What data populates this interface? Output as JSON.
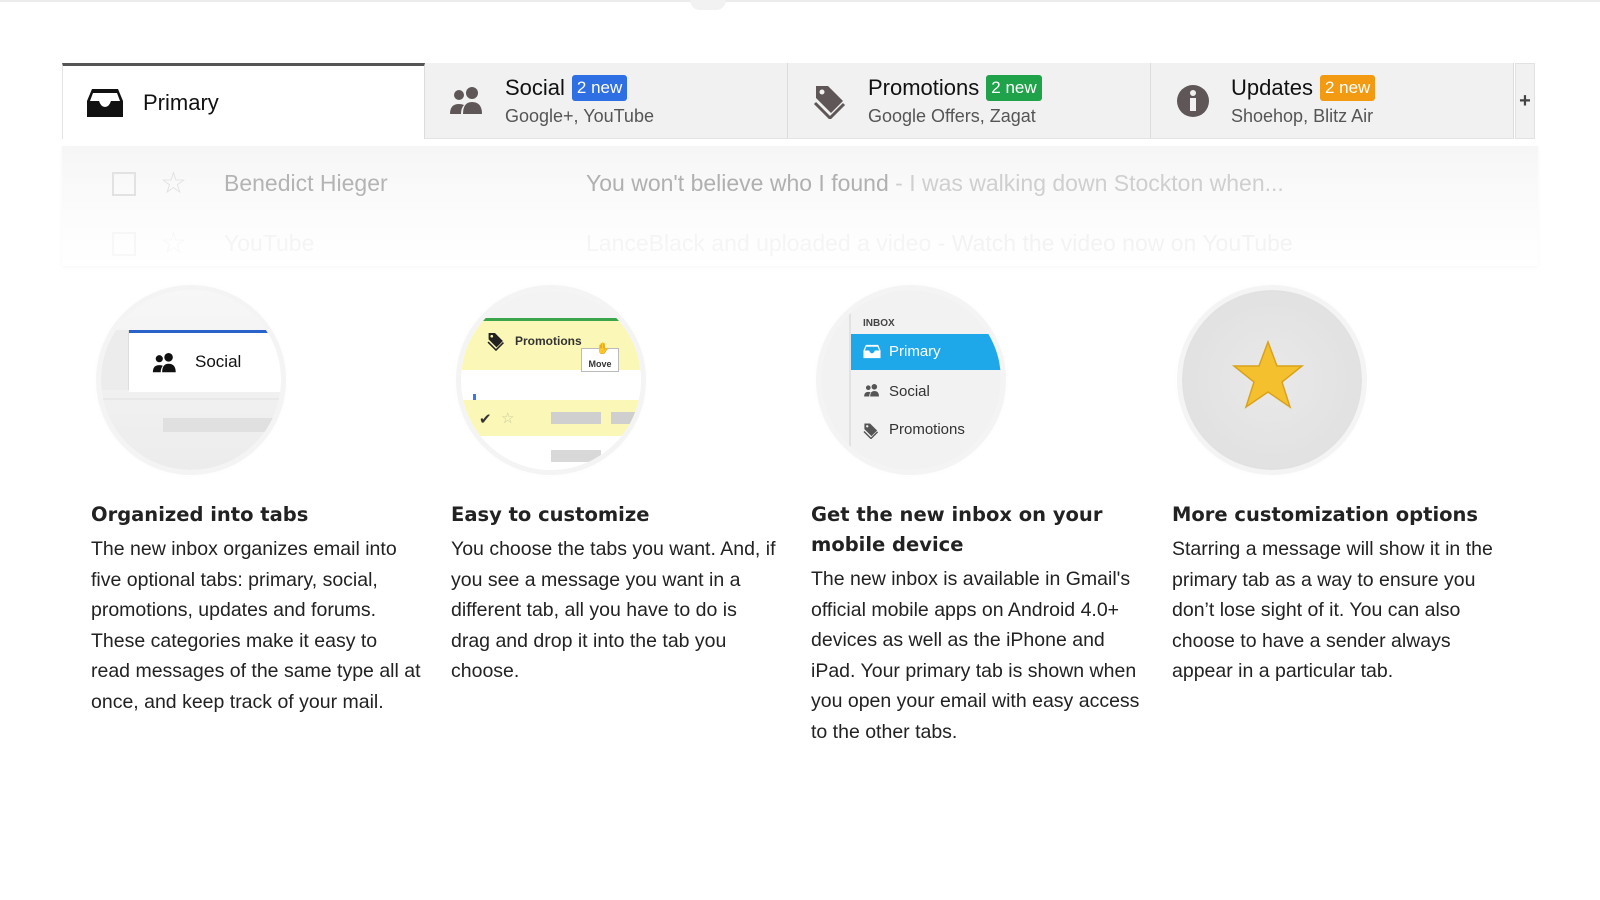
{
  "tabs": [
    {
      "label": "Primary",
      "icon": "inbox-icon",
      "active": true
    },
    {
      "label": "Social",
      "badge": "2 new",
      "badge_color": "#2f6fe4",
      "subtitle": "Google+, YouTube",
      "icon": "people-icon"
    },
    {
      "label": "Promotions",
      "badge": "2 new",
      "badge_color": "#1fa24a",
      "subtitle": "Google Offers, Zagat",
      "icon": "tag-icon"
    },
    {
      "label": "Updates",
      "badge": "2 new",
      "badge_color": "#f29a12",
      "subtitle": "Shoehop, Blitz Air",
      "icon": "info-icon"
    }
  ],
  "add_tab_label": "+",
  "emails": [
    {
      "sender": "Benedict Hieger",
      "subject": "You won't believe who I found",
      "snippet": " - I was walking down Stockton when..."
    },
    {
      "sender": "YouTube",
      "subject": "LanceBlack and uploaded a video",
      "snippet": " - Watch the video now on YouTube"
    }
  ],
  "features": [
    {
      "title": "Organized into tabs",
      "body": "The new inbox organizes email into five optional tabs: primary, social, promotions, updates and forums. These categories make it easy to read messages of the same type all at once, and keep track of your mail.",
      "illustration": {
        "tab_label": "Social"
      }
    },
    {
      "title": "Easy to customize",
      "body": "You choose the tabs you want. And, if you see a message you want in a different tab, all you have to do is drag and drop it into the tab you choose.",
      "illustration": {
        "tab_label": "Promotions",
        "move_label": "Move"
      }
    },
    {
      "title": "Get the new inbox on your mobile device",
      "body": "The new inbox is available in Gmail's official mobile apps on Android 4.0+ devices as well as the iPhone and iPad. Your primary tab is shown when you open your email with easy access to the other tabs.",
      "illustration": {
        "header": "INBOX",
        "items": [
          "Primary",
          "Social",
          "Promotions"
        ]
      }
    },
    {
      "title": "More customization options",
      "body": "Starring a message will show it in the primary tab as a way to ensure you don’t lose sight of it. You can also choose to have a sender always appear in a particular tab.",
      "illustration": {
        "icon": "star-icon",
        "color": "#f4c02e"
      }
    }
  ]
}
